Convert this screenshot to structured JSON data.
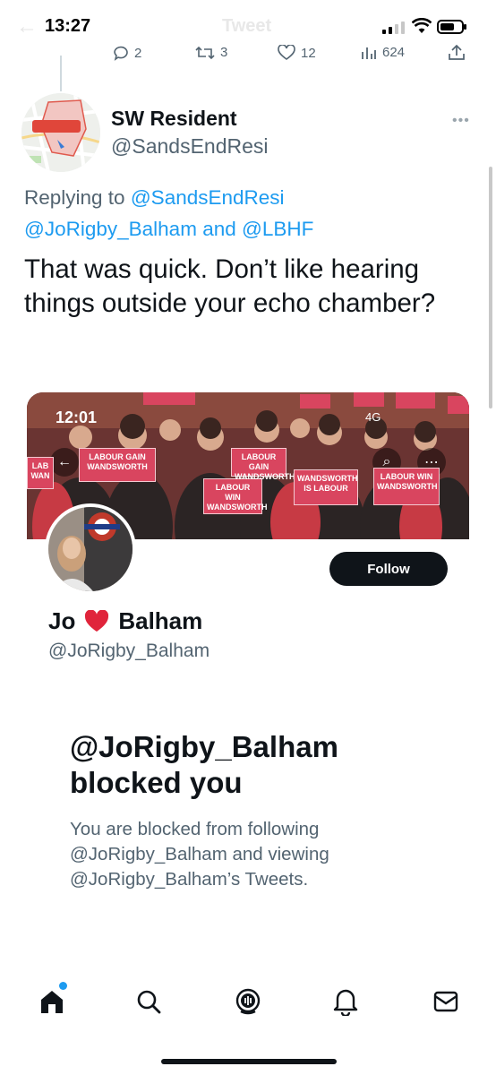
{
  "status_bar": {
    "time": "13:27",
    "nav_title": "Tweet",
    "back": "←"
  },
  "prev_tweet_actions": {
    "replies": "2",
    "retweets": "3",
    "likes": "12",
    "views": "624"
  },
  "tweet": {
    "author": {
      "display_name": "SW Resident",
      "handle": "@SandsEndResi"
    },
    "replying_prefix": "Replying to",
    "reply_to_1": "@SandsEndResi",
    "reply_to_2": "@JoRigby_Balham",
    "reply_and": "and",
    "reply_to_3": "@LBHF",
    "text": "That was quick. Don’t like hearing things outside your echo chamber?",
    "more": "•••"
  },
  "embed": {
    "status_time": "12:01",
    "status_net": "4G",
    "placards": [
      "LABOUR GAIN WANDSWORTH",
      "LABOUR WIN WANDSWORTH",
      "LABOUR GAIN WANDSWORTH",
      "WANDSWORTH IS LABOUR",
      "LABOUR WIN WANDSWORTH",
      "LAB WAN"
    ],
    "follow_label": "Follow",
    "profile_name_first": "Jo",
    "profile_name_last": "Balham",
    "profile_handle": "@JoRigby_Balham",
    "blocked_title": "@JoRigby_Balham blocked you",
    "blocked_body": "You are blocked from following @JoRigby_Balham and viewing @JoRigby_Balham’s Tweets."
  },
  "tabs": [
    "home",
    "search",
    "spaces",
    "notifications",
    "messages"
  ],
  "colors": {
    "link": "#1d9bf0",
    "text": "#0f1419",
    "secondary": "#536471",
    "placard": "#d9455f"
  }
}
